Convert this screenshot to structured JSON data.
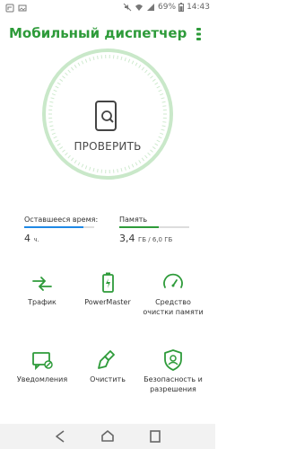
{
  "status_bar": {
    "battery": "69%",
    "time": "14:43",
    "icons": [
      "notification-icon",
      "image-icon",
      "mute-icon",
      "wifi-icon",
      "signal-icon",
      "battery-icon"
    ]
  },
  "header": {
    "title": "Мобильный диспетчер"
  },
  "check": {
    "label": "ПРОВЕРИТЬ"
  },
  "battery_time": {
    "label": "Оставшееся время:",
    "value": "4",
    "unit": "ч.",
    "level": 0.85,
    "color": "#1e88e5"
  },
  "memory": {
    "label": "Память",
    "value": "3,4",
    "unit": "ГБ / 6,0 ГБ",
    "level": 0.57,
    "color": "#2e9b3a"
  },
  "tiles": [
    {
      "label": "Трафик",
      "icon": "traffic-icon"
    },
    {
      "label": "PowerMaster",
      "icon": "battery-power-icon"
    },
    {
      "label": "Средство очистки памяти",
      "icon": "speedometer-icon"
    },
    {
      "label": "Уведомления",
      "icon": "notification-block-icon"
    },
    {
      "label": "Очистить",
      "icon": "brush-icon"
    },
    {
      "label": "Безопасность и разрешения",
      "icon": "security-user-icon"
    }
  ],
  "colors": {
    "accent": "#2e9b3a",
    "ring": "#c9e8c9",
    "blue": "#1e88e5"
  }
}
